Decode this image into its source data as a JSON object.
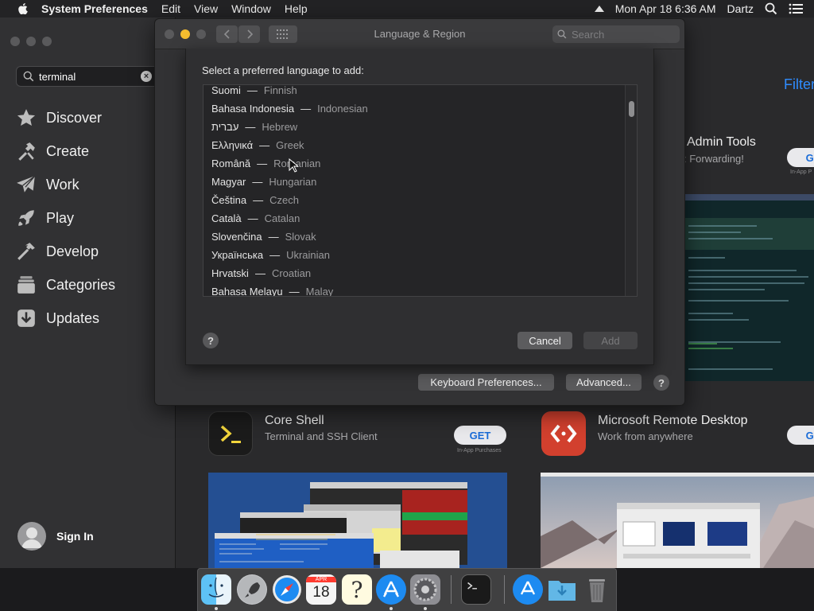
{
  "menubar": {
    "app_name": "System Preferences",
    "menus": [
      "Edit",
      "View",
      "Window",
      "Help"
    ],
    "clock": "Mon Apr 18  6:36 AM",
    "user": "Dartz"
  },
  "appstore": {
    "search_value": "terminal",
    "sidebar": [
      {
        "label": "Discover",
        "icon": "star-icon"
      },
      {
        "label": "Create",
        "icon": "hammer-brush-icon"
      },
      {
        "label": "Work",
        "icon": "paper-plane-icon"
      },
      {
        "label": "Play",
        "icon": "rocket-icon"
      },
      {
        "label": "Develop",
        "icon": "hammer-icon"
      },
      {
        "label": "Categories",
        "icon": "stack-icon"
      },
      {
        "label": "Updates",
        "icon": "download-icon"
      }
    ],
    "sign_in": "Sign In",
    "filter": "Filter",
    "apps": {
      "admin": {
        "title": "Admin Tools",
        "subtitle": ": Forwarding!",
        "get": "GE",
        "iap": "In-App P"
      },
      "coreshell": {
        "title": "Core Shell",
        "subtitle": "Terminal and SSH Client",
        "get": "GET",
        "iap": "In-App Purchases"
      },
      "msrd": {
        "title": "Microsoft Remote Desktop",
        "subtitle": "Work from anywhere",
        "get": "GE"
      }
    }
  },
  "prefs": {
    "window_title": "Language & Region",
    "search_placeholder": "Search",
    "keyboard_prefs_label": "Keyboard Preferences...",
    "advanced_label": "Advanced...",
    "help_label": "?"
  },
  "sheet": {
    "prompt": "Select a preferred language to add:",
    "languages": [
      {
        "native": "Suomi",
        "english": "Finnish"
      },
      {
        "native": "Bahasa Indonesia",
        "english": "Indonesian"
      },
      {
        "native": "עברית",
        "english": "Hebrew"
      },
      {
        "native": "Ελληνικά",
        "english": "Greek"
      },
      {
        "native": "Română",
        "english": "Romanian"
      },
      {
        "native": "Magyar",
        "english": "Hungarian"
      },
      {
        "native": "Čeština",
        "english": "Czech"
      },
      {
        "native": "Català",
        "english": "Catalan"
      },
      {
        "native": "Slovenčina",
        "english": "Slovak"
      },
      {
        "native": "Українська",
        "english": "Ukrainian"
      },
      {
        "native": "Hrvatski",
        "english": "Croatian"
      },
      {
        "native": "Bahasa Melayu",
        "english": "Malay"
      }
    ],
    "separator": "—",
    "help_label": "?",
    "cancel_label": "Cancel",
    "add_label": "Add"
  },
  "dock": {
    "items": [
      "Finder",
      "Launchpad",
      "Safari",
      "Calendar",
      "Help",
      "App Store",
      "System Preferences",
      "Terminal",
      "Applications",
      "Downloads",
      "Trash"
    ],
    "calendar_month": "APR",
    "calendar_day": "18"
  },
  "colors": {
    "accent": "#2f8cff",
    "traffic_close": "#5a5a5c",
    "traffic_minimize": "#f5bd2f"
  }
}
